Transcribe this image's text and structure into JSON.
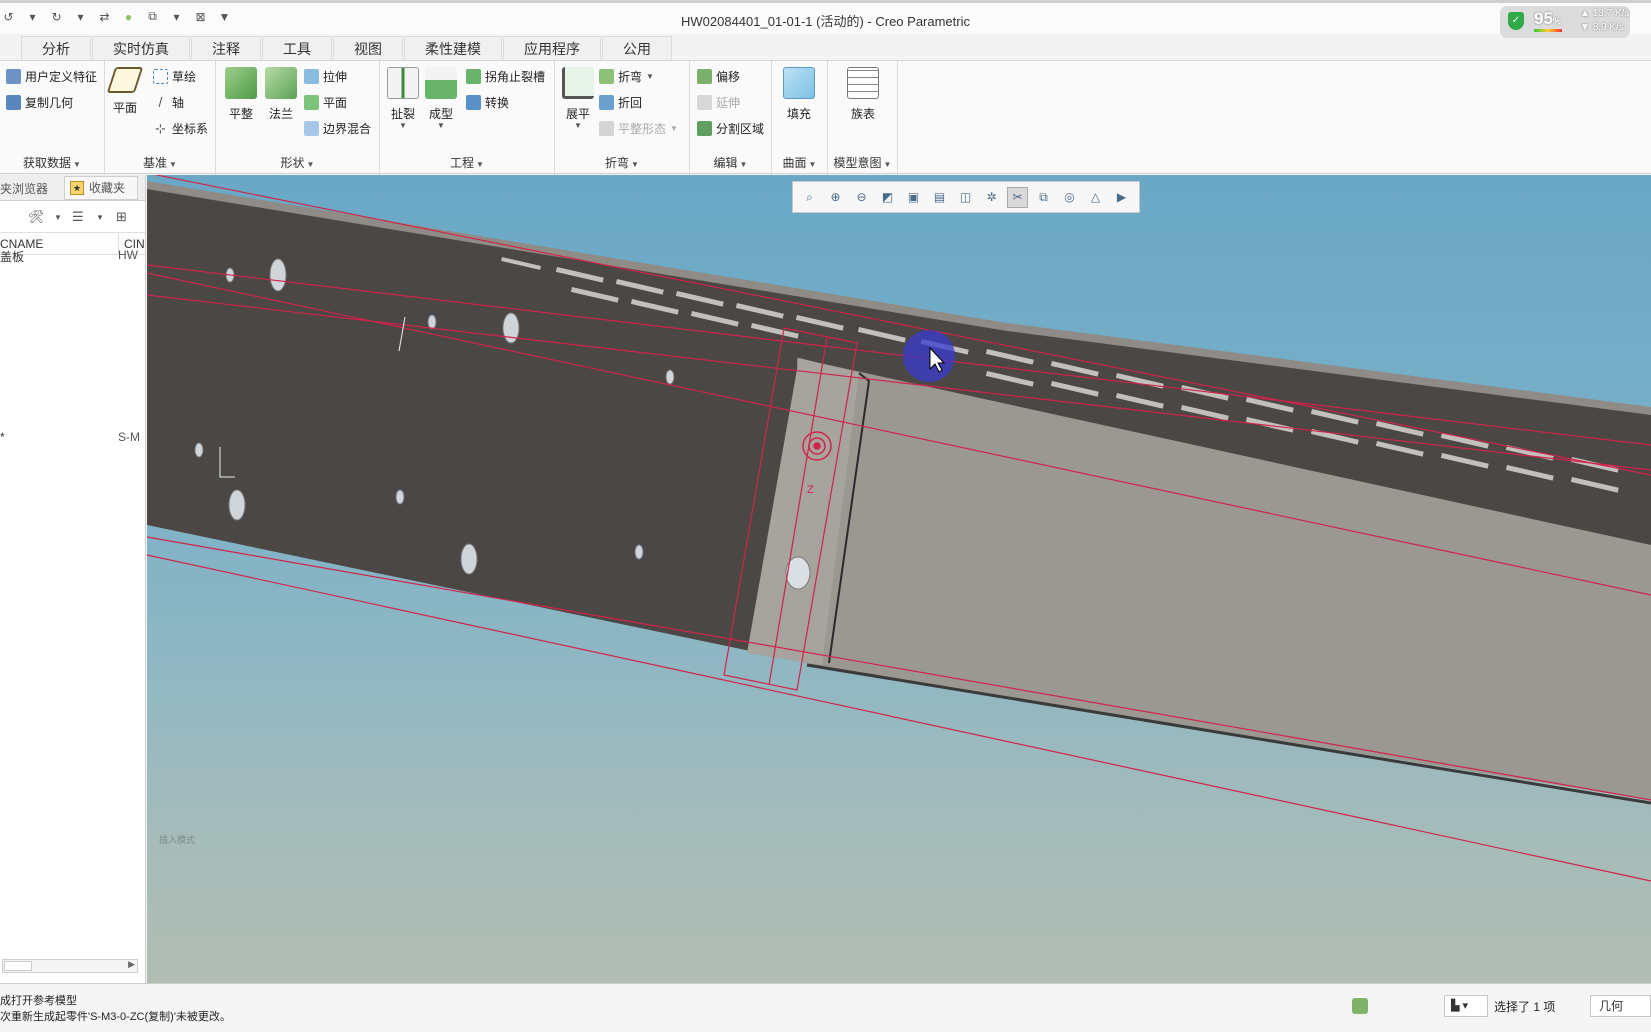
{
  "window_title": "HW02084401_01-01-1 (活动的) - Creo Parametric",
  "quick_access": [
    "↺",
    "▾",
    "↻",
    "▾",
    "⇄",
    "●",
    "⧉",
    "▾",
    "⊠",
    "▼"
  ],
  "net_widget": {
    "percent": "95",
    "unit": "%",
    "upload": "13.7 K/s",
    "download": "8.9 K/s"
  },
  "tabs": [
    "分析",
    "实时仿真",
    "注释",
    "工具",
    "视图",
    "柔性建模",
    "应用程序",
    "公用"
  ],
  "ribbon": {
    "get_data": {
      "label": "获取数据",
      "items": [
        "用户定义特征",
        "复制几何"
      ]
    },
    "datum": {
      "label": "基准",
      "plane": "平面",
      "items": [
        "草绘",
        "轴",
        "坐标系"
      ]
    },
    "shapes": {
      "label": "形状",
      "big": [
        "平整",
        "法兰"
      ],
      "items": [
        "拉伸",
        "平面",
        "边界混合"
      ]
    },
    "engineering": {
      "label": "工程",
      "big": [
        "扯裂",
        "成型"
      ],
      "items": [
        "拐角止裂槽",
        "转换"
      ]
    },
    "bends": {
      "label": "折弯",
      "big": [
        "展平"
      ],
      "items": [
        "折弯",
        "折回",
        "平整形态"
      ]
    },
    "editing": {
      "label": "编辑",
      "items": [
        "偏移",
        "延伸",
        "分割区域"
      ]
    },
    "surfaces": {
      "label": "曲面",
      "big": [
        "填充"
      ]
    },
    "model_intent": {
      "label": "模型意图",
      "big": [
        "族表"
      ]
    }
  },
  "left_panel": {
    "tab_browser": "夹浏览器",
    "tab_favorites": "收藏夹",
    "col1": "CNAME",
    "col2": "CIN",
    "rows": [
      {
        "name": "盖板",
        "value": "HW"
      },
      {
        "name": "*",
        "value": "S-M"
      }
    ]
  },
  "viewport": {
    "mode_label": "插入模式",
    "dim_label": "Z"
  },
  "view_toolbar": [
    "⌕",
    "⊕",
    "⊖",
    "◩",
    "▣",
    "▤",
    "◫",
    "✲",
    "✂",
    "⧉",
    "◎",
    "△",
    "▶"
  ],
  "status": {
    "line1": "成打开参考模型",
    "line2": "次重新生成起零件'S-M3-0-ZC(复制)'未被更改。",
    "filter_icon": "▙ ▾",
    "selected": "选择了 1 项",
    "filter_value": "几何"
  }
}
